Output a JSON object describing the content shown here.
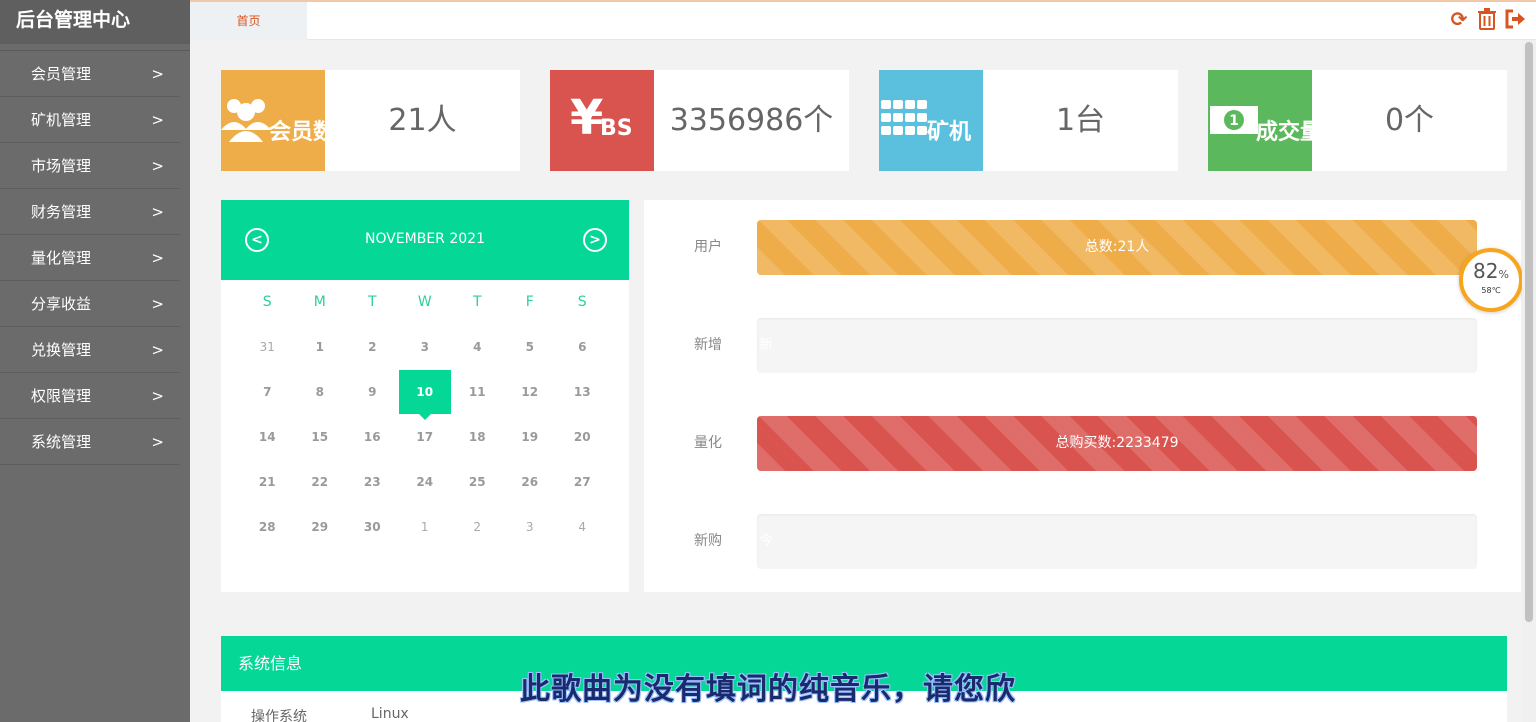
{
  "sidebar": {
    "brand": "后台管理中心",
    "items": [
      {
        "label": "会员管理"
      },
      {
        "label": "矿机管理"
      },
      {
        "label": "市场管理"
      },
      {
        "label": "财务管理"
      },
      {
        "label": "量化管理"
      },
      {
        "label": "分享收益"
      },
      {
        "label": "兑换管理"
      },
      {
        "label": "权限管理"
      },
      {
        "label": "系统管理"
      }
    ],
    "chevron": ">"
  },
  "header": {
    "tab_home": "首页",
    "icons": [
      "refresh-icon",
      "trash-icon",
      "logout-icon"
    ]
  },
  "cards": [
    {
      "label": "会员数",
      "value": "21人",
      "icon": "users-icon",
      "color": "#efad49"
    },
    {
      "label": "BS",
      "value": "3356986个",
      "icon": "yen-icon",
      "color": "#d9534f"
    },
    {
      "label": "矿机",
      "value": "1台",
      "icon": "grid-icon",
      "color": "#5bc0de"
    },
    {
      "label": "成交量",
      "value": "0个",
      "icon": "money-icon",
      "color": "#5cb85c"
    }
  ],
  "calendar": {
    "title": "NOVEMBER 2021",
    "weekdays": [
      "S",
      "M",
      "T",
      "W",
      "T",
      "F",
      "S"
    ],
    "weeks": [
      [
        "31",
        "1",
        "2",
        "3",
        "4",
        "5",
        "6"
      ],
      [
        "7",
        "8",
        "9",
        "10",
        "11",
        "12",
        "13"
      ],
      [
        "14",
        "15",
        "16",
        "17",
        "18",
        "19",
        "20"
      ],
      [
        "21",
        "22",
        "23",
        "24",
        "25",
        "26",
        "27"
      ],
      [
        "28",
        "29",
        "30",
        "1",
        "2",
        "3",
        "4"
      ]
    ],
    "today": "10",
    "accent": "#05d896"
  },
  "progress": [
    {
      "label": "用户",
      "text": "总数:21人",
      "fill": 1.0,
      "style": "yellow"
    },
    {
      "label": "新增",
      "text": "新",
      "fill": 0.0,
      "style": "empty"
    },
    {
      "label": "量化",
      "text": "总购买数:2233479",
      "fill": 1.0,
      "style": "red"
    },
    {
      "label": "新购",
      "text": "今",
      "fill": 0.0,
      "style": "empty"
    }
  ],
  "gauge": {
    "percent": "82",
    "unit": "%",
    "temp": "58℃"
  },
  "system": {
    "title": "系统信息",
    "rows": [
      {
        "key": "操作系统",
        "value": "Linux"
      }
    ]
  },
  "subtitle": "此歌曲为没有填词的纯音乐，请您欣"
}
